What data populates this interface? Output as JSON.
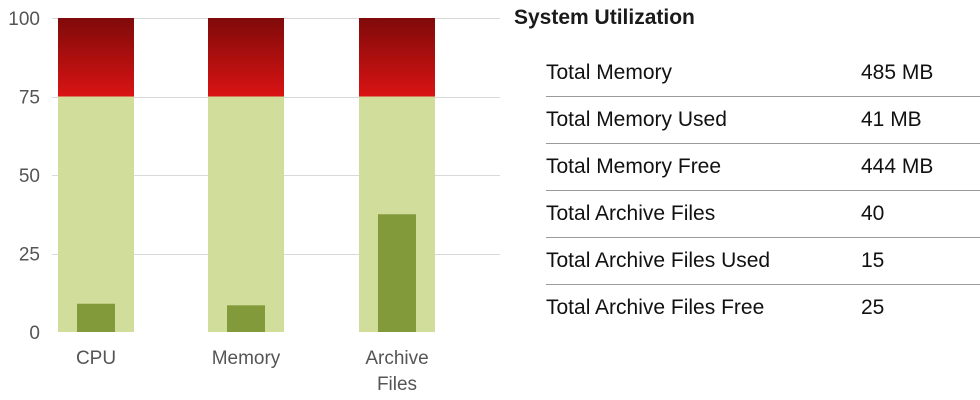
{
  "chart_data": {
    "type": "bar",
    "categories": [
      [
        "CPU"
      ],
      [
        "Memory"
      ],
      [
        "Archive",
        "Files"
      ]
    ],
    "series": [
      {
        "name": "Used",
        "values": [
          9,
          8.5,
          37.5
        ]
      }
    ],
    "bands": [
      {
        "from": 0,
        "to": 75,
        "color": "#d1dd9a"
      },
      {
        "from": 75,
        "to": 100,
        "color_top": "#7f0a0a",
        "color_bottom": "#da1313"
      }
    ],
    "bar_color": "#829a3a",
    "ylim": [
      0,
      100
    ],
    "yticks": [
      "0",
      "25",
      "50",
      "75",
      "100"
    ],
    "ytick_values": [
      0,
      25,
      50,
      75,
      100
    ],
    "grid": true,
    "title": "",
    "xlabel": "",
    "ylabel": ""
  },
  "panel": {
    "title": "System Utilization",
    "rows": [
      {
        "label": "Total Memory",
        "value": "485 MB"
      },
      {
        "label": "Total Memory Used",
        "value": "41 MB"
      },
      {
        "label": "Total Memory Free",
        "value": "444 MB"
      },
      {
        "label": "Total Archive Files",
        "value": "40"
      },
      {
        "label": "Total Archive Files Used",
        "value": "15"
      },
      {
        "label": "Total Archive Files Free",
        "value": "25"
      }
    ]
  }
}
